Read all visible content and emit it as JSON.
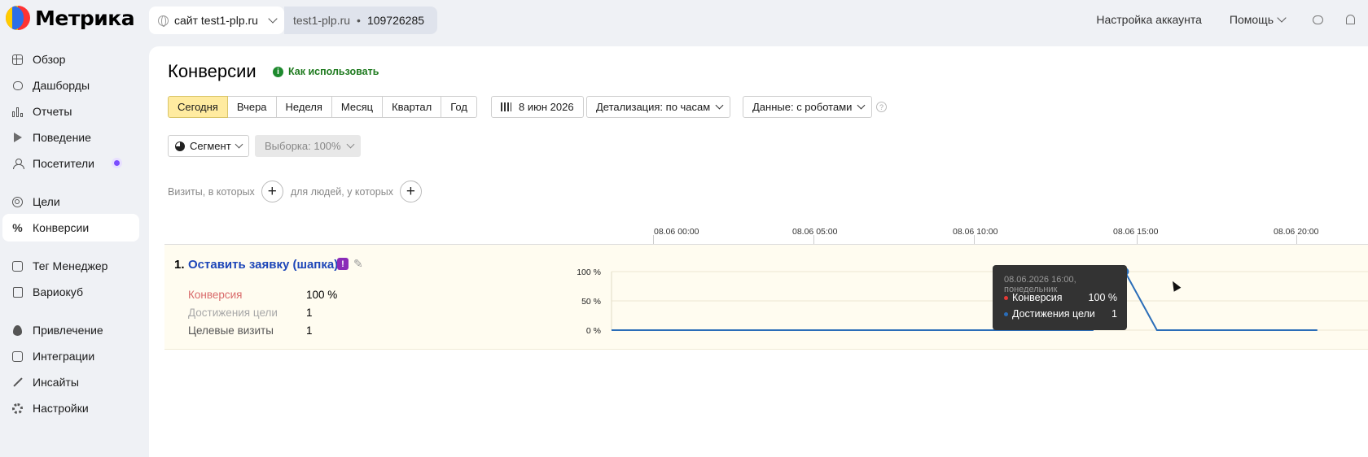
{
  "header": {
    "logo_text": "Метрика",
    "site_select": "сайт test1-plp.ru",
    "counter_site": "test1-plp.ru",
    "counter_sep": "•",
    "counter_id": "109726285",
    "account_settings": "Настройка аккаунта",
    "help": "Помощь"
  },
  "sidebar": {
    "items": [
      {
        "label": "Обзор",
        "icon": "grid-icon"
      },
      {
        "label": "Дашборды",
        "icon": "dashboard-icon"
      },
      {
        "label": "Отчеты",
        "icon": "bar-chart-icon"
      },
      {
        "label": "Поведение",
        "icon": "play-icon"
      },
      {
        "label": "Посетители",
        "icon": "user-icon"
      },
      {
        "label": "Цели",
        "icon": "target-icon"
      },
      {
        "label": "Конверсии",
        "icon": "percent-icon"
      },
      {
        "label": "Тег Менеджер",
        "icon": "tag-icon"
      },
      {
        "label": "Вариокуб",
        "icon": "list-icon"
      },
      {
        "label": "Привлечение",
        "icon": "fire-icon"
      },
      {
        "label": "Интеграции",
        "icon": "puzzle-icon"
      },
      {
        "label": "Инсайты",
        "icon": "wand-icon"
      },
      {
        "label": "Настройки",
        "icon": "gear-icon"
      }
    ],
    "active": "Конверсии"
  },
  "main": {
    "title": "Конверсии",
    "how_to": "Как использовать",
    "periods": [
      "Сегодня",
      "Вчера",
      "Неделя",
      "Месяц",
      "Квартал",
      "Год"
    ],
    "selected_period": "Сегодня",
    "date": "8 июн 2026",
    "detail": "Детализация: по часам",
    "data_mode": "Данные: с роботами",
    "segment": "Сегмент",
    "sample": "Выборка: 100%",
    "filter_visits": "Визиты, в которых",
    "filter_people": "для людей, у которых",
    "time_labels": [
      "08.06 00:00",
      "08.06 05:00",
      "08.06 10:00",
      "08.06 15:00",
      "08.06 20:00"
    ]
  },
  "goal": {
    "number": "1.",
    "name": "Оставить заявку (шапка)",
    "badge": "!",
    "metrics": [
      {
        "label": "Конверсия",
        "value": "100 %",
        "color": "#d96a6a"
      },
      {
        "label": "Достижения цели",
        "value": "1",
        "color": "#a8a8a8"
      },
      {
        "label": "Целевые визиты",
        "value": "1",
        "color": "#555555"
      }
    ]
  },
  "chart_data": {
    "type": "line",
    "y_tick_labels": [
      "100 %",
      "50 %",
      "0 %"
    ],
    "x_hours": [
      0,
      1,
      2,
      3,
      4,
      5,
      6,
      7,
      8,
      9,
      10,
      11,
      12,
      13,
      14,
      15,
      16,
      17,
      18,
      19,
      20,
      21,
      22
    ],
    "series": [
      {
        "name": "Конверсия",
        "color": "#e53935",
        "values": [
          0,
          0,
          0,
          0,
          0,
          0,
          0,
          0,
          0,
          0,
          0,
          0,
          0,
          0,
          0,
          0,
          100,
          0,
          0,
          0,
          0,
          0,
          0
        ]
      },
      {
        "name": "Достижения цели",
        "color": "#2a6db8",
        "values": [
          0,
          0,
          0,
          0,
          0,
          0,
          0,
          0,
          0,
          0,
          0,
          0,
          0,
          0,
          0,
          0,
          1,
          0,
          0,
          0,
          0,
          0,
          0
        ]
      }
    ],
    "highlight_hour": 16
  },
  "tooltip": {
    "header": "08.06.2026 16:00, понедельник",
    "rows": [
      {
        "label": "Конверсия",
        "value": "100 %",
        "color": "#e53935"
      },
      {
        "label": "Достижения цели",
        "value": "1",
        "color": "#2a6db8"
      }
    ]
  }
}
